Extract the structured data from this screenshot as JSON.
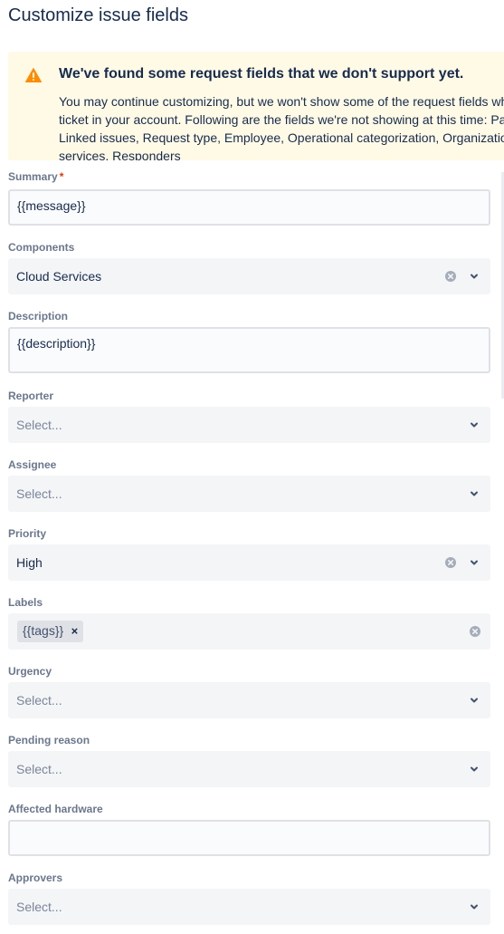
{
  "page": {
    "title": "Customize issue fields"
  },
  "warning": {
    "title": "We've found some request fields that we don't support yet.",
    "body": "You may continue customizing, but we won't show some of the request fields when we create the ticket in your account. Following are the fields we're not showing at this time: Parent, Attachment, Linked issues, Request type, Employee, Operational categorization, Organizations, Affected services, Responders"
  },
  "fields": {
    "summary": {
      "label": "Summary",
      "required_mark": "*",
      "value": "{{message}}"
    },
    "components": {
      "label": "Components",
      "value": "Cloud Services"
    },
    "description": {
      "label": "Description",
      "value": "{{description}}"
    },
    "reporter": {
      "label": "Reporter",
      "placeholder": "Select..."
    },
    "assignee": {
      "label": "Assignee",
      "placeholder": "Select..."
    },
    "priority": {
      "label": "Priority",
      "value": "High"
    },
    "labels": {
      "label": "Labels",
      "tag": "{{tags}}",
      "tag_remove": "×"
    },
    "urgency": {
      "label": "Urgency",
      "placeholder": "Select..."
    },
    "pending_reason": {
      "label": "Pending reason",
      "placeholder": "Select..."
    },
    "affected_hardware": {
      "label": "Affected hardware",
      "value": ""
    },
    "approvers": {
      "label": "Approvers",
      "placeholder": "Select..."
    }
  },
  "icons": {
    "warning": "warning-icon",
    "clear": "clear-icon",
    "chevron": "chevron-down-icon"
  },
  "colors": {
    "warning_bg": "#fffae6",
    "warning_icon": "#ff8b00",
    "required": "#de350b",
    "field_bg": "#f4f5f7",
    "label": "#6b778c"
  }
}
